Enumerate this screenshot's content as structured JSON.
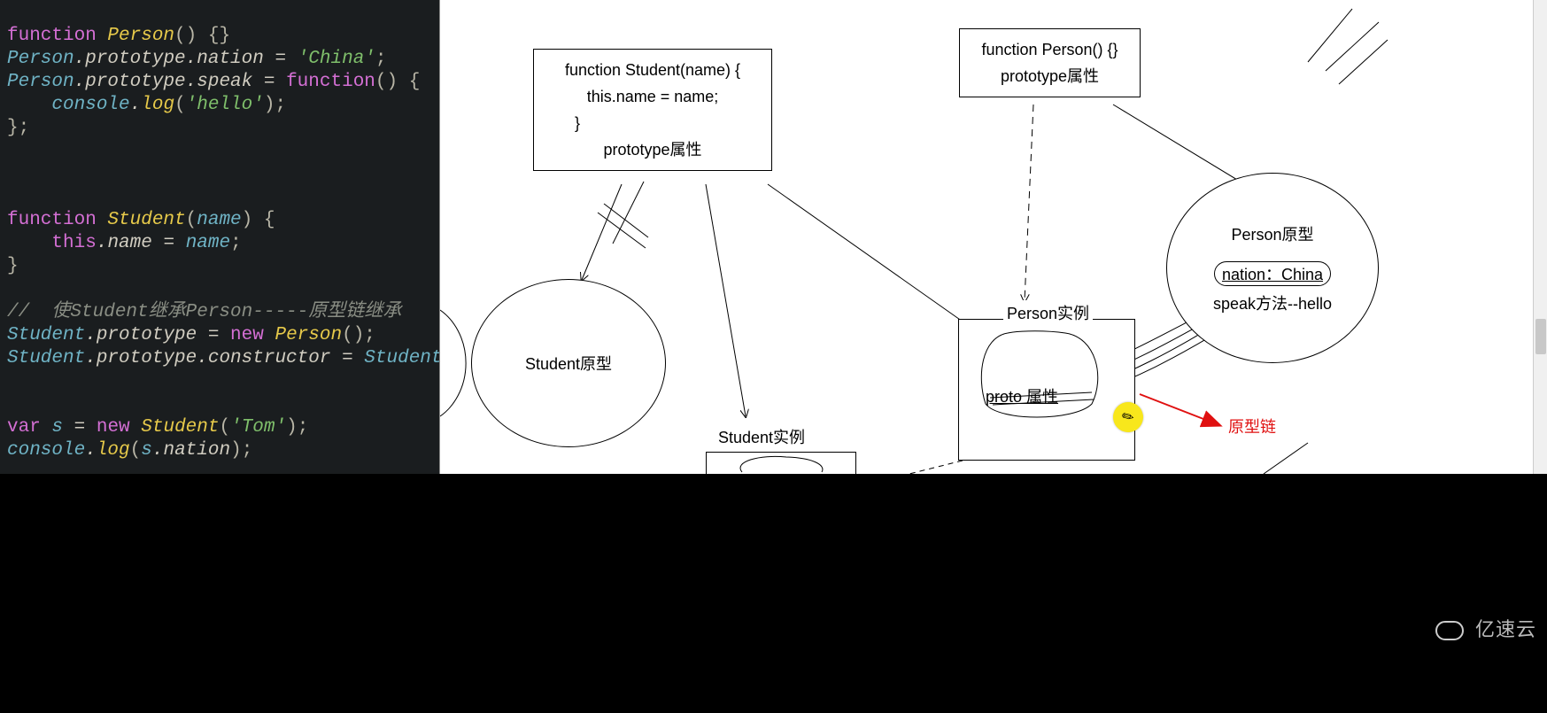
{
  "code": {
    "l1": {
      "kw": "function ",
      "fn": "Person",
      "rest": "() {}"
    },
    "l2": {
      "id": "Person",
      "p1": ".prototype.",
      "prop": "nation",
      "eq": " = ",
      "str": "'China'",
      "end": ";"
    },
    "l3": {
      "id": "Person",
      "p1": ".prototype.",
      "prop": "speak",
      "eq": " = ",
      "kw": "function",
      "rest": "() {"
    },
    "l4": {
      "indent": "    ",
      "id": "console",
      "p1": ".",
      "fn": "log",
      "open": "(",
      "str": "'hello'",
      "close": ");"
    },
    "l5": "};",
    "l6": {
      "kw": "function ",
      "fn": "Student",
      "open": "(",
      "id": "name",
      "rest": ") {"
    },
    "l7": {
      "indent": "    ",
      "kw": "this",
      "p1": ".",
      "prop": "name",
      "eq": " = ",
      "id": "name",
      "end": ";"
    },
    "l8": "}",
    "l9": "//  使Student继承Person-----原型链继承",
    "l10": {
      "id": "Student",
      "p1": ".prototype = ",
      "kw": "new ",
      "fn": "Person",
      "rest": "();"
    },
    "l11": {
      "id": "Student",
      "p1": ".prototype.",
      "prop": "constructor",
      "eq": " = ",
      "id2": "Student",
      "end": ";"
    },
    "l12": {
      "kw": "var ",
      "id": "s",
      "eq": " = ",
      "kw2": "new ",
      "fn": "Student",
      "open": "(",
      "str": "'Tom'",
      "close": ");"
    },
    "l13": {
      "id": "console",
      "p1": ".",
      "fn": "log",
      "open": "(",
      "id2": "s",
      "p2": ".",
      "prop": "nation",
      "close": ");"
    }
  },
  "diagram": {
    "box_student_fn": {
      "line1": "function  Student(name) {",
      "line2": "this.name = name;",
      "line3": "}",
      "line4": "prototype属性"
    },
    "box_person_fn": {
      "line1": "function Person() {}",
      "line2": "prototype属性"
    },
    "circle_student_proto": "Student原型",
    "circle_person_proto": {
      "title": "Person原型",
      "p1": "nation：China",
      "p2": "speak方法--hello"
    },
    "box_person_instance": {
      "title": "Person实例",
      "proto": "proto   属性"
    },
    "label_student_instance": "Student实例",
    "label_chain": "原型链",
    "pencil": "✎"
  },
  "watermark": "亿速云"
}
